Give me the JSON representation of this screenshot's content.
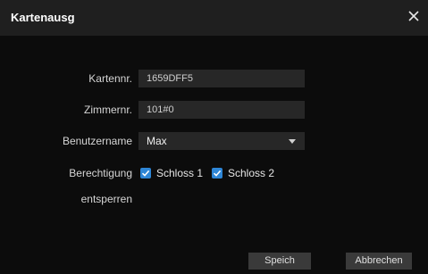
{
  "dialog": {
    "title": "Kartenausg"
  },
  "form": {
    "card_no": {
      "label": "Kartennr.",
      "value": "1659DFF5"
    },
    "room_no": {
      "label": "Zimmernr.",
      "value": "101#0"
    },
    "username": {
      "label": "Benutzername",
      "value": "Max"
    },
    "permission": {
      "label_line1": "Berechtigung",
      "label_line2": "entsperren",
      "options": [
        {
          "label": "Schloss 1",
          "checked": true
        },
        {
          "label": "Schloss 2",
          "checked": true
        }
      ]
    }
  },
  "buttons": {
    "save": "Speich",
    "cancel": "Abbrechen"
  },
  "colors": {
    "background": "#0c0c0c",
    "titlebar": "#1f1f1f",
    "input": "#272727",
    "checkbox": "#2e86d6",
    "button": "#3a3a3a"
  },
  "icons": {
    "close": "close-icon",
    "dropdown": "chevron-down-icon",
    "checkmark": "check-icon"
  }
}
